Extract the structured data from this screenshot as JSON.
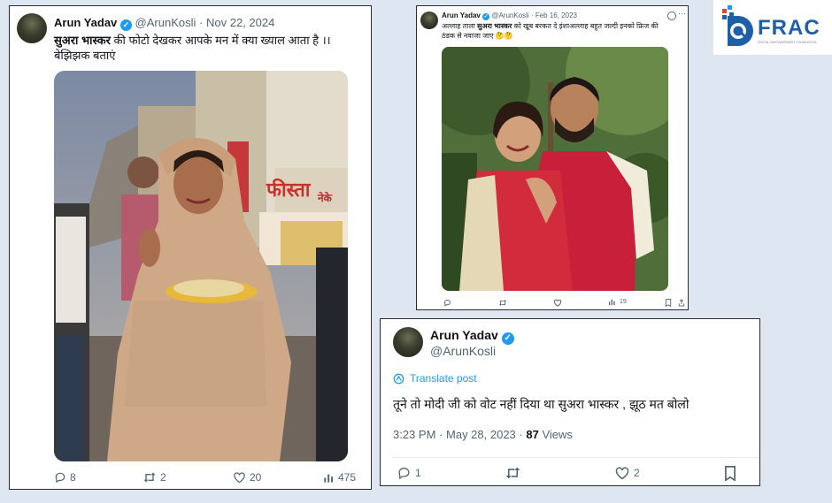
{
  "post1": {
    "name": "Arun Yadav",
    "handle": "@ArunKosli",
    "separator": "·",
    "date": "Nov 22, 2024",
    "text_bold": "सुअरा भास्कर",
    "text_rest": " की फोटो देखकर आपके मन में क्या ख्याल आता है ।।",
    "text_line2": "बेझिझक बताएं",
    "shop_sign": "फीस्ता",
    "shop_sign2": "नेके",
    "replies": "8",
    "reposts": "2",
    "likes": "20",
    "views": "475"
  },
  "post2": {
    "name": "Arun Yadav",
    "handle": "@ArunKosli",
    "separator": "·",
    "date": "Feb 16, 2023",
    "text_pre": "अल्लाह ताला ",
    "text_bold": "सुअरा भास्कर",
    "text_rest": " को खूब बरकत दे इंशाअल्लाह बहुत जल्दी इनको फ्रिज की",
    "text_line2": "ठंडक से नवाजा जाए 🤔🤔",
    "views": "19"
  },
  "post3": {
    "name": "Arun Yadav",
    "handle": "@ArunKosli",
    "translate": "Translate post",
    "text": "तूने तो मोदी जी को वोट नहीं दिया था सुअरा भास्कर , झूठ मत बोलो",
    "time": "3:23 PM",
    "separator": "·",
    "date": "May 28, 2023",
    "sep2": "·",
    "views_count": "87",
    "views_label": "Views",
    "replies": "1",
    "likes": "2"
  },
  "logo": {
    "text": "FRAC",
    "tagline": "DIGITAL EMPOWERMENT FOUNDATION"
  },
  "colors": {
    "background": "#dde6f1",
    "verified": "#1d9bf0",
    "translate_link": "#1d9bf0",
    "logo_blue": "#1f5fa8",
    "logo_accent": "#e8412c"
  }
}
